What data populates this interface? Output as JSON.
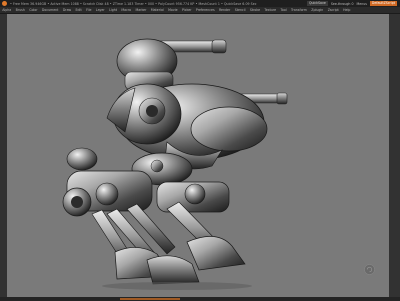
{
  "titlebar": {
    "status_text": "• Free Mem 36.946GB • Active Mem 1088 • Scratch Disk 48 • ZTime 1.183 Timer • 000 • PolyCount 956.774 KP • MeshCount 1 • QuickSave 6.09 Sec",
    "quicksave_label": "QuickSave",
    "see_through_label": "See-through 0",
    "menus_label": "Menus",
    "default_label": "DefaultZScript"
  },
  "menubar": {
    "items": [
      "Alpha",
      "Brush",
      "Color",
      "Document",
      "Draw",
      "Edit",
      "File",
      "Layer",
      "Light",
      "Macro",
      "Marker",
      "Material",
      "Movie",
      "Picker",
      "Preferences",
      "Render",
      "Stencil",
      "Stroke",
      "Texture",
      "Tool",
      "Transform",
      "Zplugin",
      "Zscript",
      "Help"
    ]
  },
  "colors": {
    "canvas_bg": "#7a7a7a",
    "accent": "#d06a24"
  },
  "icons": [
    "logo-icon",
    "navigation-gizmo-icon"
  ]
}
